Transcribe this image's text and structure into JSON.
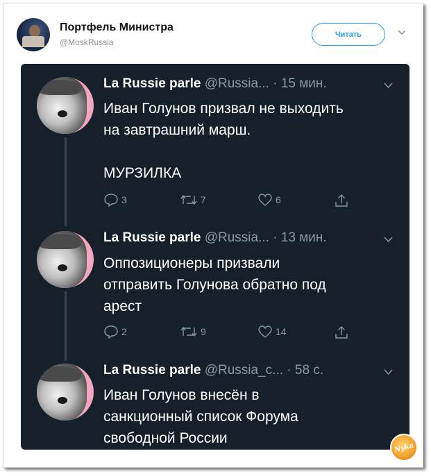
{
  "outer_tweet": {
    "name": "Портфель Министра",
    "handle": "@MoskRussia",
    "follow_label": "Читать"
  },
  "tweets": [
    {
      "author": "La Russie parle",
      "handle": "@Russia...",
      "time": "· 15 мин.",
      "lines": [
        "Иван Голунов призвал не выходить",
        "на завтрашний марш.",
        "",
        "МУРЗИЛКА"
      ],
      "replies": "3",
      "retweets": "7",
      "likes": "6"
    },
    {
      "author": "La Russie parle",
      "handle": "@Russia...",
      "time": "· 13 мин.",
      "lines": [
        "Оппозиционеры призвали",
        "отправить Голунова обратно под",
        "арест"
      ],
      "replies": "2",
      "retweets": "9",
      "likes": "14"
    },
    {
      "author": "La Russie parle",
      "handle": "@Russia_c...",
      "time": "· 58 с.",
      "lines": [
        "Иван Голунов внесён в",
        "санкционный список Форума",
        "свободной России"
      ]
    }
  ],
  "watermark": "Nyka",
  "colors": {
    "card_bg": "#15202b",
    "muted": "#8899a6",
    "accent": "#1da1f2",
    "avatar_bg": "#f3a6c0"
  }
}
